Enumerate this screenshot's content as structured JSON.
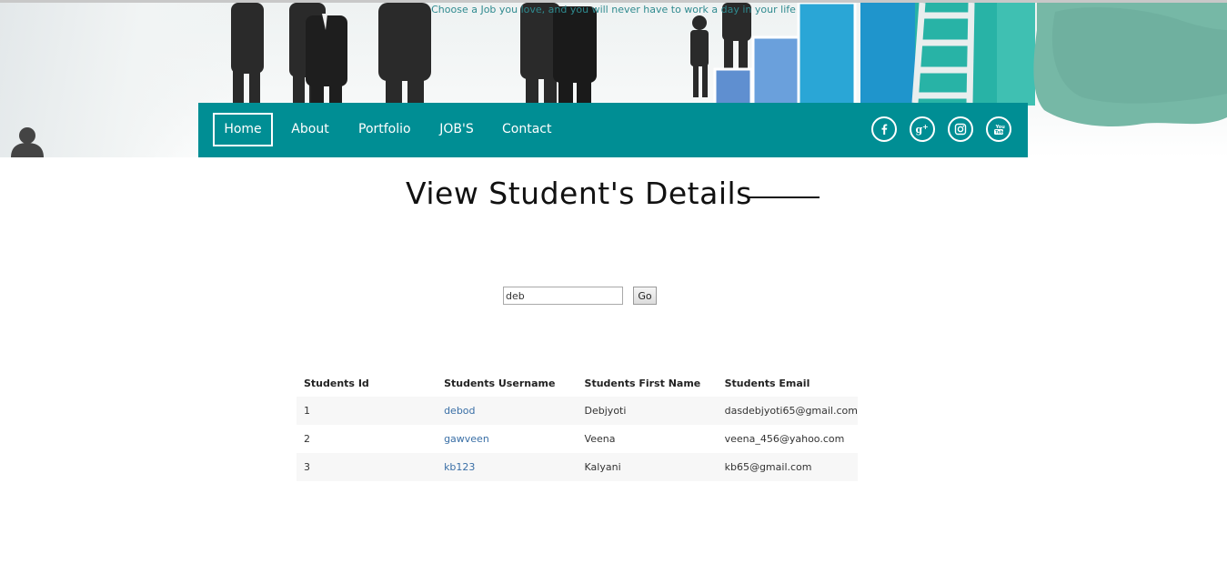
{
  "header": {
    "tagline": "Choose a Job you love, and you will never have to work a day in your life"
  },
  "nav": {
    "items": [
      {
        "label": "Home",
        "active": true
      },
      {
        "label": "About",
        "active": false
      },
      {
        "label": "Portfolio",
        "active": false
      },
      {
        "label": "JOB'S",
        "active": false
      },
      {
        "label": "Contact",
        "active": false
      }
    ],
    "social": [
      "facebook-icon",
      "google-plus-icon",
      "instagram-icon",
      "youtube-icon"
    ]
  },
  "main": {
    "title": "View Student's Details",
    "search": {
      "value": "deb",
      "button_label": "Go"
    },
    "table": {
      "headers": [
        "Students Id",
        "Students Username",
        "Students First Name",
        "Students Email"
      ],
      "rows": [
        {
          "id": "1",
          "username": "debod",
          "first_name": "Debjyoti",
          "email": "dasdebjyoti65@gmail.com"
        },
        {
          "id": "2",
          "username": "gawveen",
          "first_name": "Veena",
          "email": "veena_456@yahoo.com"
        },
        {
          "id": "3",
          "username": "kb123",
          "first_name": "Kalyani",
          "email": "kb65@gmail.com"
        }
      ]
    }
  },
  "colors": {
    "nav_background": "#008e94",
    "link": "#3a6fa6",
    "tagline": "#2f8a8f"
  }
}
